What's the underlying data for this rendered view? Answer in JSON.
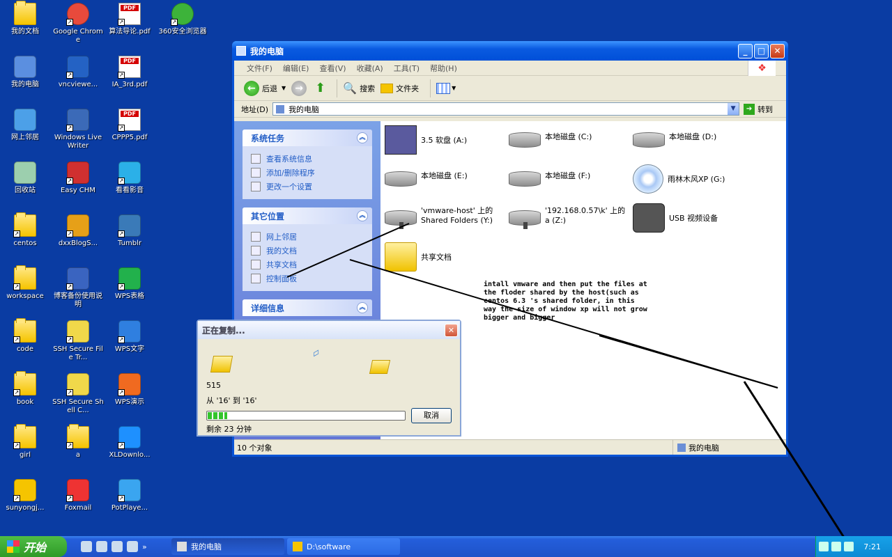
{
  "desktop": {
    "icons": [
      {
        "label": "我的文档",
        "kind": "folder"
      },
      {
        "label": "我的电脑",
        "kind": "computer"
      },
      {
        "label": "网上邻居",
        "kind": "network"
      },
      {
        "label": "回收站",
        "kind": "recycle"
      },
      {
        "label": "centos",
        "kind": "folder"
      },
      {
        "label": "workspace",
        "kind": "folder"
      },
      {
        "label": "code",
        "kind": "folder"
      },
      {
        "label": "book",
        "kind": "folder"
      },
      {
        "label": "girl",
        "kind": "folder"
      },
      {
        "label": "sunyongj...",
        "kind": "help"
      },
      {
        "label": "Google Chrome",
        "kind": "chrome"
      },
      {
        "label": "vncviewe...",
        "kind": "vnc"
      },
      {
        "label": "Windows Live Writer",
        "kind": "writer"
      },
      {
        "label": "Easy CHM",
        "kind": "chm"
      },
      {
        "label": "dxxBlogS...",
        "kind": "blog"
      },
      {
        "label": "博客备份使用说明",
        "kind": "doc"
      },
      {
        "label": "SSH Secure File Tr...",
        "kind": "ssh"
      },
      {
        "label": "SSH Secure Shell C...",
        "kind": "ssh"
      },
      {
        "label": "a",
        "kind": "folder"
      },
      {
        "label": "Foxmail",
        "kind": "foxmail"
      },
      {
        "label": "算法导论.pdf",
        "kind": "pdf"
      },
      {
        "label": "IA_3rd.pdf",
        "kind": "pdf"
      },
      {
        "label": "CPPP5.pdf",
        "kind": "pdf"
      },
      {
        "label": "看看影音",
        "kind": "player"
      },
      {
        "label": "Tumblr",
        "kind": "tumblr"
      },
      {
        "label": "WPS表格",
        "kind": "wps-s"
      },
      {
        "label": "WPS文字",
        "kind": "wps-w"
      },
      {
        "label": "WPS演示",
        "kind": "wps-p"
      },
      {
        "label": "XLDownlo...",
        "kind": "xl"
      },
      {
        "label": "PotPlaye...",
        "kind": "pot"
      },
      {
        "label": "360安全浏览器",
        "kind": "360"
      }
    ]
  },
  "explorer": {
    "title": "我的电脑",
    "menu": [
      "文件(F)",
      "编辑(E)",
      "查看(V)",
      "收藏(A)",
      "工具(T)",
      "帮助(H)"
    ],
    "toolbar": {
      "back": "后退",
      "search": "搜索",
      "folders": "文件夹"
    },
    "address": {
      "label": "地址(D)",
      "value": "我的电脑",
      "go": "转到"
    },
    "sidebar": {
      "system_tasks": {
        "title": "系统任务",
        "items": [
          "查看系统信息",
          "添加/删除程序",
          "更改一个设置"
        ]
      },
      "other_places": {
        "title": "其它位置",
        "items": [
          "网上邻居",
          "我的文档",
          "共享文档",
          "控制面板"
        ]
      },
      "details": {
        "title": "详细信息"
      }
    },
    "files": [
      {
        "name": "3.5 软盘 (A:)",
        "kind": "floppy"
      },
      {
        "name": "本地磁盘 (C:)",
        "kind": "drive"
      },
      {
        "name": "本地磁盘 (D:)",
        "kind": "drive"
      },
      {
        "name": "本地磁盘 (E:)",
        "kind": "drive"
      },
      {
        "name": "本地磁盘 (F:)",
        "kind": "drive"
      },
      {
        "name": "雨林木风XP (G:)",
        "kind": "cd"
      },
      {
        "name": "'vmware-host' 上的 Shared Folders (Y:)",
        "kind": "netdrive"
      },
      {
        "name": "'192.168.0.57\\k' 上的 a (Z:)",
        "kind": "netdrive"
      },
      {
        "name": "USB 视频设备",
        "kind": "camera"
      },
      {
        "name": "共享文档",
        "kind": "folder"
      }
    ],
    "status": {
      "count": "10 个对象",
      "location": "我的电脑"
    }
  },
  "copy_dialog": {
    "title": "正在复制...",
    "filename": "515",
    "from_to": "从 '16' 到 '16'",
    "remaining": "剩余 23 分钟",
    "cancel": "取消",
    "progress": 0.1
  },
  "annotation": "intall vmware and then put the files at the floder shared by the host(such as centos 6.3 's shared folder, in this way the size of window xp will not grow bigger and bigger",
  "taskbar": {
    "start": "开始",
    "tasks": [
      "我的电脑",
      "D:\\software"
    ],
    "clock": "7:21"
  }
}
